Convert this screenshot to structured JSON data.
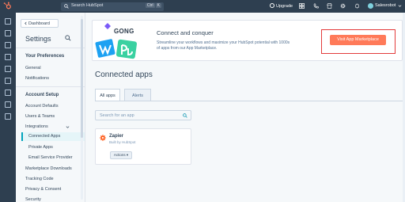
{
  "topbar": {
    "search_label": "Search HubSpot",
    "shortcut_key": "Ctrl",
    "shortcut_letter": "K",
    "upgrade_label": "Upgrade",
    "account_name": "Salesrobot"
  },
  "sidebar": {
    "back_label": "Dashboard",
    "title": "Settings",
    "preferences_heading": "Your Preferences",
    "preferences_items": [
      "General",
      "Notifications"
    ],
    "account_setup_heading": "Account Setup",
    "account_items": [
      "Account Defaults",
      "Users & Teams",
      "Integrations"
    ],
    "integration_items": [
      "Connected Apps",
      "Private Apps",
      "Email Service Provider"
    ],
    "more_items": [
      "Marketplace Downloads",
      "Tracking Code",
      "Privacy & Consent",
      "Security"
    ]
  },
  "banner": {
    "logo_text": "GONG",
    "title": "Connect and conquer",
    "description": "Streamline your workflows and maximize your HubSpot potential with 1000s of apps from our App Marketplace.",
    "cta_label": "Visit App Marketplace"
  },
  "main": {
    "heading": "Connected apps",
    "tabs": [
      "All apps",
      "Alerts"
    ],
    "search_placeholder": "Search for an app"
  },
  "apps": [
    {
      "name": "Zapier",
      "by": "Built by HubSpot",
      "actions_label": "Actions"
    }
  ],
  "colors": {
    "accent": "#ff7a59",
    "nav": "#2e3f50",
    "teal": "#00a4bd",
    "highlight": "#e33b3b"
  }
}
